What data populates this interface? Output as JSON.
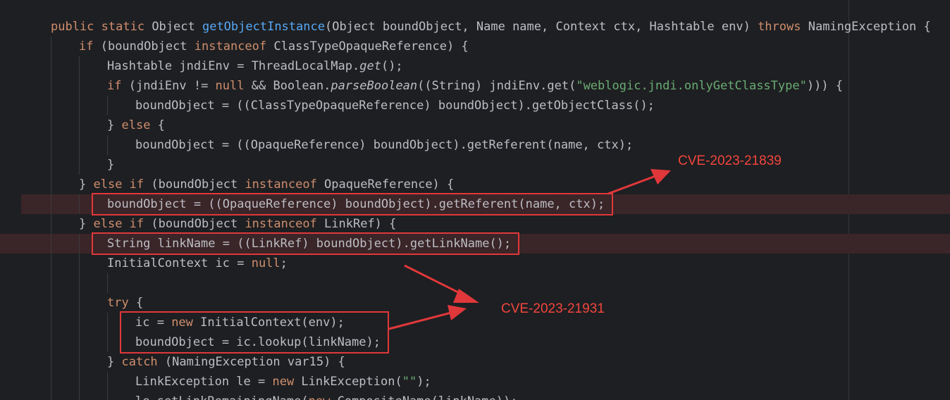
{
  "code": {
    "lines": [
      {
        "indent": 0,
        "tokens": [
          {
            "t": "public ",
            "c": "kw"
          },
          {
            "t": "static ",
            "c": "kw"
          },
          {
            "t": "Object "
          },
          {
            "t": "getObjectInstance",
            "c": "fn"
          },
          {
            "t": "(Object boundObject, Name name, Context ctx, Hashtable env) "
          },
          {
            "t": "throws ",
            "c": "kw"
          },
          {
            "t": "NamingException {"
          }
        ]
      },
      {
        "indent": 1,
        "tokens": [
          {
            "t": "if ",
            "c": "kw"
          },
          {
            "t": "(boundObject "
          },
          {
            "t": "instanceof ",
            "c": "kw"
          },
          {
            "t": "ClassTypeOpaqueReference) {"
          }
        ]
      },
      {
        "indent": 2,
        "tokens": [
          {
            "t": "Hashtable jndiEnv = ThreadLocalMap."
          },
          {
            "t": "get",
            "c": "it"
          },
          {
            "t": "();"
          }
        ]
      },
      {
        "indent": 2,
        "tokens": [
          {
            "t": "if ",
            "c": "kw"
          },
          {
            "t": "(jndiEnv != "
          },
          {
            "t": "null ",
            "c": "kw"
          },
          {
            "t": "&& Boolean."
          },
          {
            "t": "parseBoolean",
            "c": "it"
          },
          {
            "t": "((String) jndiEnv.get("
          },
          {
            "t": "\"weblogic.jndi.onlyGetClassType\"",
            "c": "str"
          },
          {
            "t": "))) {"
          }
        ]
      },
      {
        "indent": 3,
        "tokens": [
          {
            "t": "boundObject = ((ClassTypeOpaqueReference) boundObject).getObjectClass();"
          }
        ]
      },
      {
        "indent": 2,
        "tokens": [
          {
            "t": "} "
          },
          {
            "t": "else ",
            "c": "kw"
          },
          {
            "t": "{"
          }
        ]
      },
      {
        "indent": 3,
        "tokens": [
          {
            "t": "boundObject = ((OpaqueReference) boundObject).getReferent(name, ctx);"
          }
        ]
      },
      {
        "indent": 2,
        "tokens": [
          {
            "t": "}"
          }
        ]
      },
      {
        "indent": 1,
        "tokens": [
          {
            "t": "} "
          },
          {
            "t": "else if ",
            "c": "kw"
          },
          {
            "t": "(boundObject "
          },
          {
            "t": "instanceof ",
            "c": "kw"
          },
          {
            "t": "OpaqueReference) {"
          }
        ]
      },
      {
        "indent": 2,
        "tokens": [
          {
            "t": "boundObject = ((OpaqueReference) boundObject).getReferent(name, ctx);"
          }
        ]
      },
      {
        "indent": 1,
        "tokens": [
          {
            "t": "} "
          },
          {
            "t": "else if ",
            "c": "kw"
          },
          {
            "t": "(boundObject "
          },
          {
            "t": "instanceof ",
            "c": "kw"
          },
          {
            "t": "LinkRef) {"
          }
        ]
      },
      {
        "indent": 2,
        "tokens": [
          {
            "t": "String linkName = ((LinkRef) boundObject).getLinkName();"
          }
        ]
      },
      {
        "indent": 2,
        "tokens": [
          {
            "t": "InitialContext ic = "
          },
          {
            "t": "null",
            "c": "kw"
          },
          {
            "t": ";"
          }
        ]
      },
      {
        "indent": 0,
        "tokens": []
      },
      {
        "indent": 2,
        "tokens": [
          {
            "t": "try ",
            "c": "kw"
          },
          {
            "t": "{"
          }
        ]
      },
      {
        "indent": 3,
        "tokens": [
          {
            "t": "ic = "
          },
          {
            "t": "new ",
            "c": "kw"
          },
          {
            "t": "InitialContext(env);"
          }
        ]
      },
      {
        "indent": 3,
        "tokens": [
          {
            "t": "boundObject = ic.lookup(linkName);"
          }
        ]
      },
      {
        "indent": 2,
        "tokens": [
          {
            "t": "} "
          },
          {
            "t": "catch ",
            "c": "kw"
          },
          {
            "t": "(NamingException var15) {"
          }
        ]
      },
      {
        "indent": 3,
        "tokens": [
          {
            "t": "LinkException le = "
          },
          {
            "t": "new ",
            "c": "kw"
          },
          {
            "t": "LinkException("
          },
          {
            "t": "\"\"",
            "c": "str"
          },
          {
            "t": ");"
          }
        ]
      },
      {
        "indent": 3,
        "tokens": [
          {
            "t": "le.setLinkRemainingName("
          },
          {
            "t": "new ",
            "c": "kw"
          },
          {
            "t": "CompositeName(linkName));"
          }
        ]
      }
    ]
  },
  "highlights": [
    {
      "line": 9,
      "full": false
    },
    {
      "line": 11,
      "full": true
    }
  ],
  "annotations": {
    "cve1": {
      "label": "CVE-2023-21839",
      "lines": [
        9
      ]
    },
    "cve2": {
      "label": "CVE-2023-21931",
      "lines": [
        11,
        15,
        16
      ]
    }
  },
  "colors": {
    "background": "#1e1f22",
    "text": "#bcbec4",
    "keyword": "#cf8e6d",
    "function": "#56a8f5",
    "string": "#6aab73",
    "annotation": "#e0383a",
    "annotation_text": "#f2453d",
    "line_highlight": "#3a2528"
  }
}
